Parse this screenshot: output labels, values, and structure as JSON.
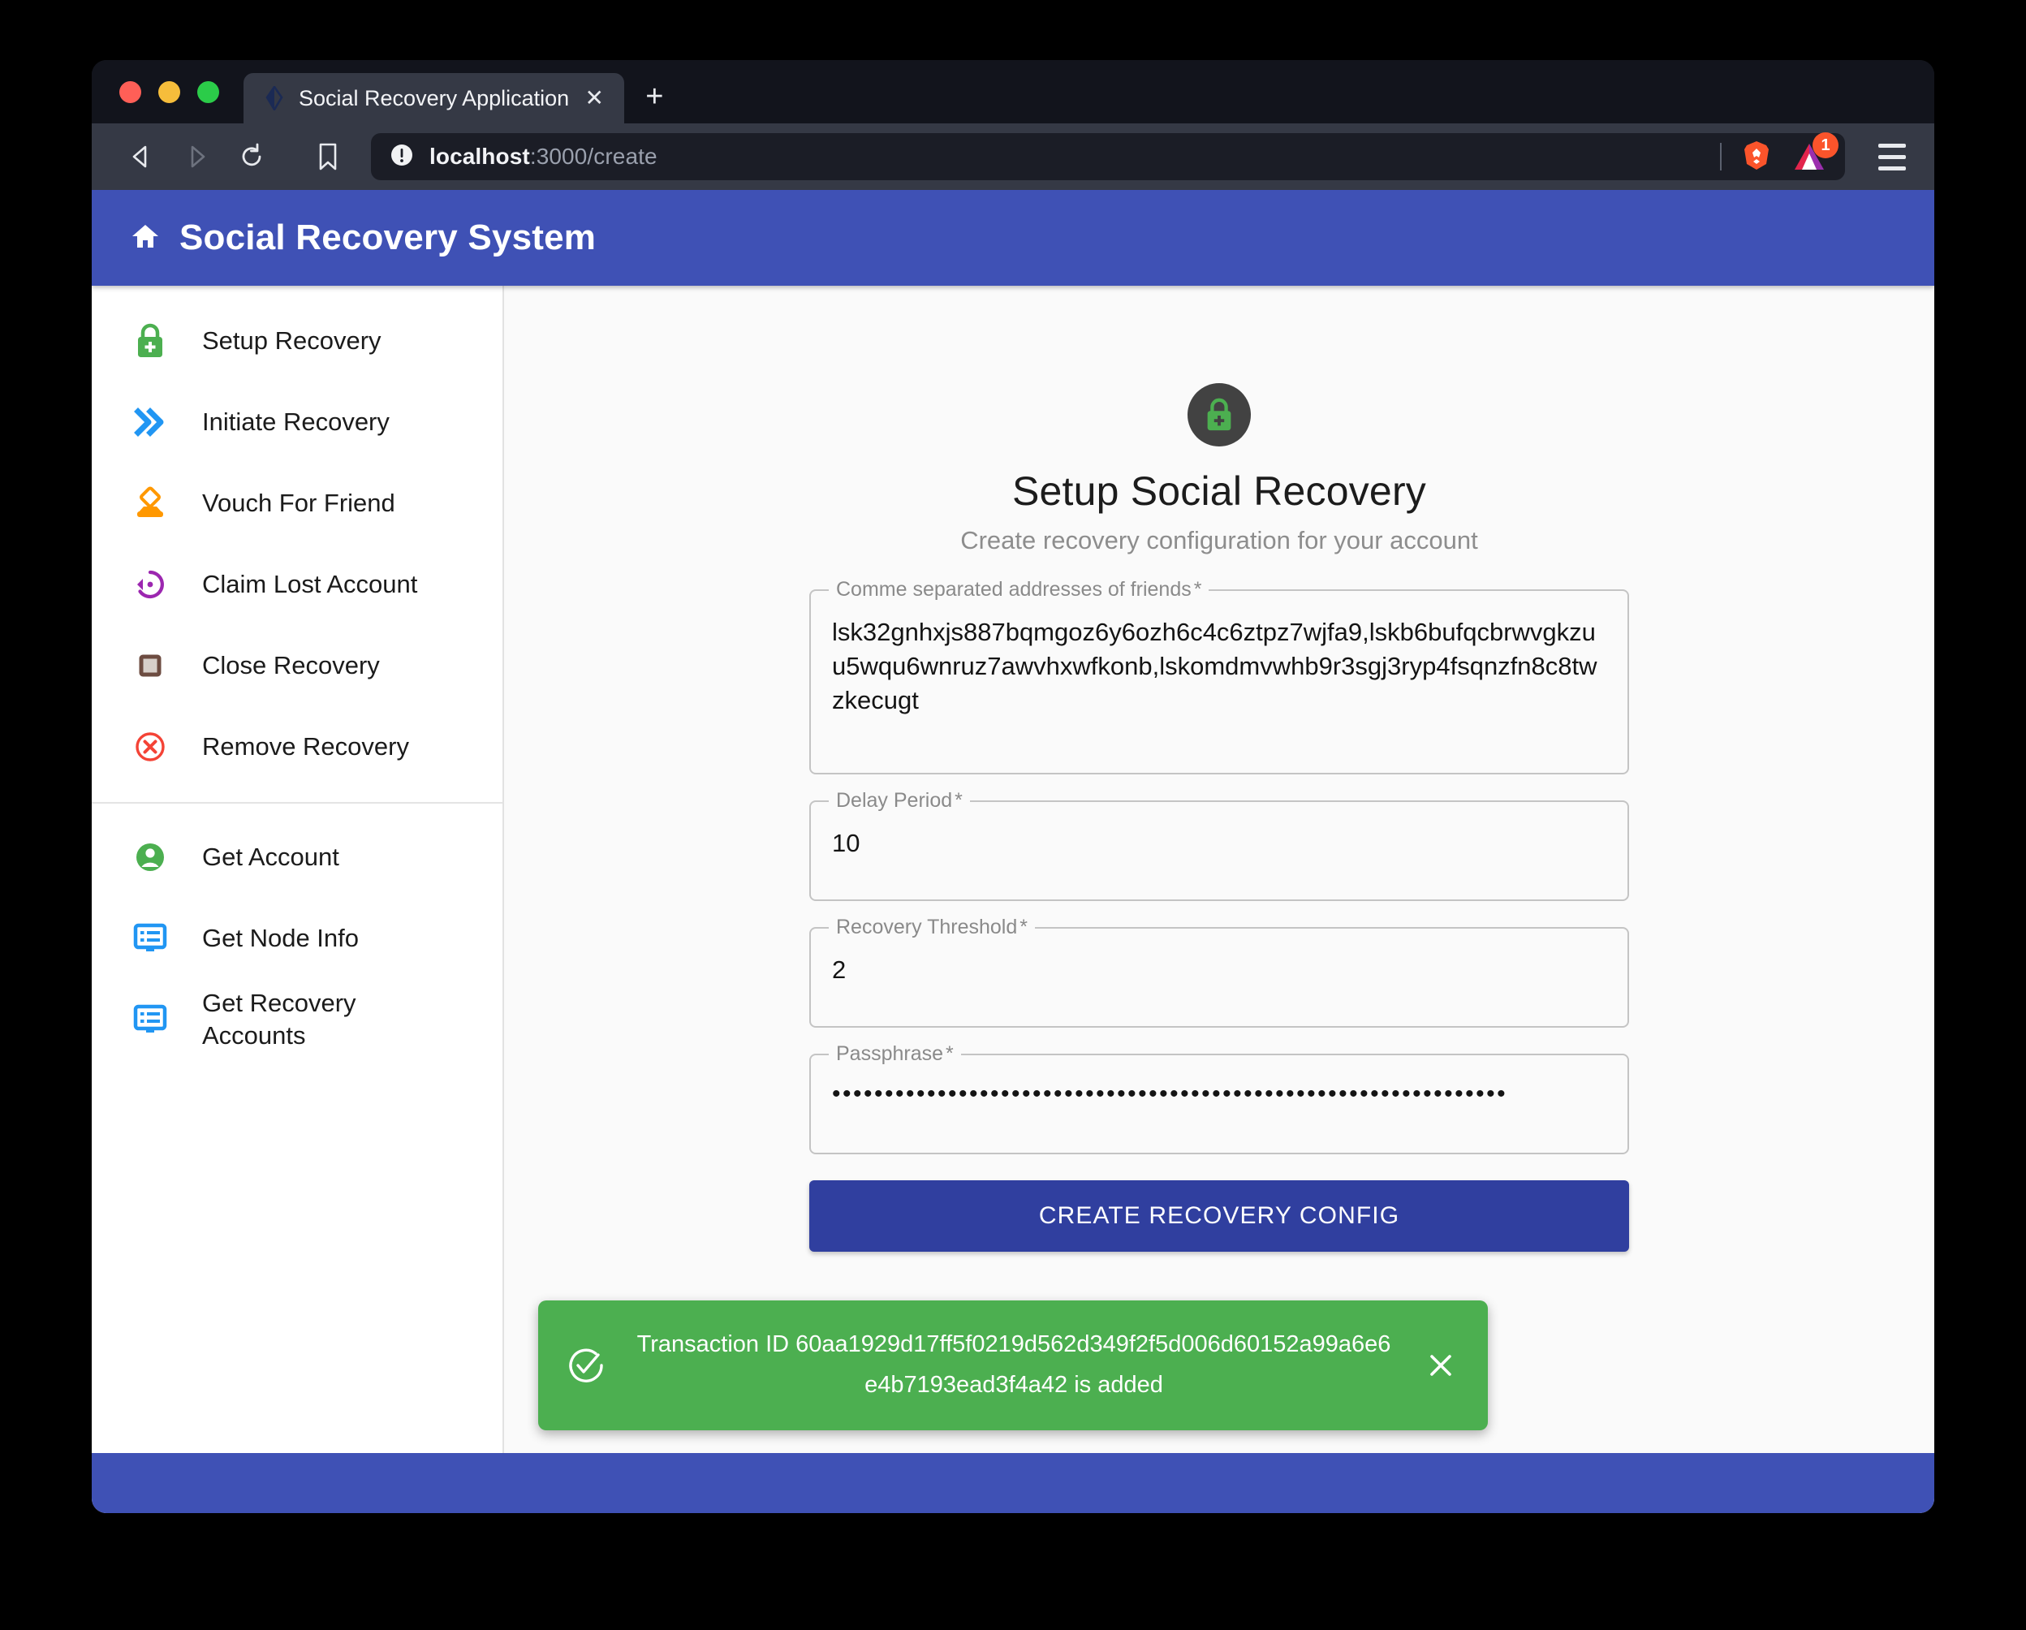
{
  "browser": {
    "tab": {
      "title": "Social Recovery Application",
      "favicon_icon": "lisk-logo-icon",
      "close_icon": "close-icon"
    },
    "new_tab_label": "+",
    "toolbar": {
      "back_icon": "back-arrow-icon",
      "forward_icon": "forward-arrow-icon",
      "reload_icon": "reload-icon",
      "bookmark_icon": "bookmark-icon",
      "info_icon": "site-info-icon",
      "url_host": "localhost",
      "url_path": ":3000/create",
      "brave_shield_icon": "brave-lion-icon",
      "bat_icon": "bat-triangle-icon",
      "bat_badge_count": "1",
      "menu_icon": "hamburger-menu-icon"
    }
  },
  "app": {
    "header": {
      "home_icon": "home-icon",
      "title": "Social Recovery System",
      "accent_color": "#3f51b5"
    },
    "sidebar": {
      "group_one": [
        {
          "label": "Setup Recovery",
          "icon": "lock-plus-icon",
          "color": "#4caf50"
        },
        {
          "label": "Initiate Recovery",
          "icon": "double-chevron-right-icon",
          "color": "#2196f3"
        },
        {
          "label": "Vouch For Friend",
          "icon": "vouch-upload-icon",
          "color": "#ff9800"
        },
        {
          "label": "Claim Lost Account",
          "icon": "restore-clock-icon",
          "color": "#9c27b0"
        },
        {
          "label": "Close Recovery",
          "icon": "stop-square-icon",
          "color": "#795548"
        },
        {
          "label": "Remove Recovery",
          "icon": "circle-x-icon",
          "color": "#f44336"
        }
      ],
      "group_two": [
        {
          "label": "Get Account",
          "icon": "account-circle-icon",
          "color": "#4caf50"
        },
        {
          "label": "Get Node Info",
          "icon": "node-list-icon",
          "color": "#2196f3"
        },
        {
          "label": "Get Recovery Accounts",
          "icon": "node-list-icon",
          "color": "#2196f3"
        }
      ]
    },
    "form": {
      "avatar_icon": "lock-plus-icon",
      "title": "Setup Social Recovery",
      "subtitle": "Create recovery configuration for your account",
      "fields": {
        "friends": {
          "label": "Comme separated addresses of friends",
          "required_mark": "*",
          "value": "lsk32gnhxjs887bqmgoz6y6ozh6c4c6ztpz7wjfa9,lskb6bufqcbrwvgkzuu5wqu6wnruz7awvhxwfkonb,lskomdmvwhb9r3sgj3ryp4fsqnzfn8c8twzkecugt"
        },
        "delay": {
          "label": "Delay Period",
          "required_mark": "*",
          "value": "10"
        },
        "threshold": {
          "label": "Recovery Threshold",
          "required_mark": "*",
          "value": "2"
        },
        "passphrase": {
          "label": "Passphrase",
          "required_mark": "*",
          "value": "••••••••••••••••••••••••••••••••••••••••••••••••••••••••••••••••"
        }
      },
      "submit_label": "CREATE RECOVERY CONFIG"
    },
    "snackbar": {
      "success_icon": "check-circle-icon",
      "message": "Transaction ID 60aa1929d17ff5f0219d562d349f2f5d006d60152a99a6e6e4b7193ead3f4a42 is added",
      "close_icon": "close-icon",
      "color": "#4caf50"
    }
  }
}
